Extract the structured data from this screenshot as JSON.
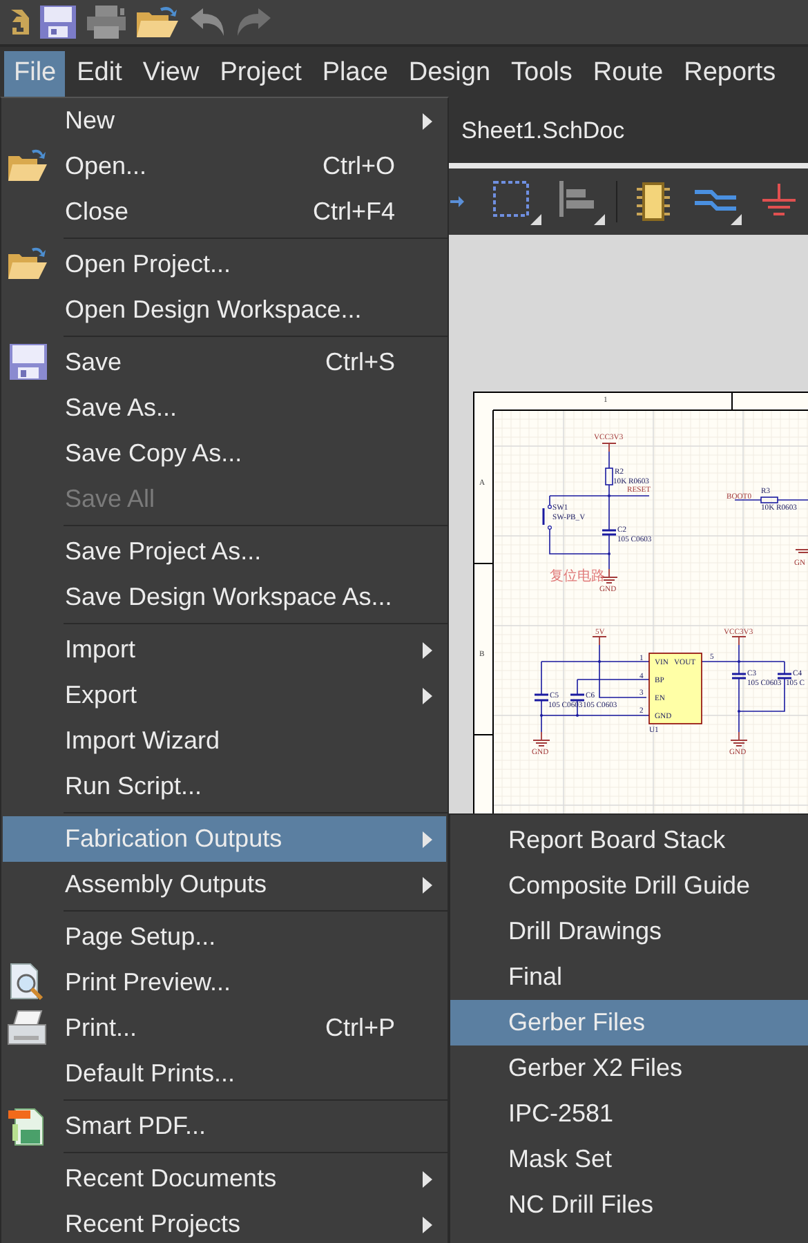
{
  "menu_bar": [
    {
      "label": "File",
      "selected": true
    },
    {
      "label": "Edit",
      "selected": false
    },
    {
      "label": "View",
      "selected": false
    },
    {
      "label": "Project",
      "selected": false
    },
    {
      "label": "Place",
      "selected": false
    },
    {
      "label": "Design",
      "selected": false
    },
    {
      "label": "Tools",
      "selected": false
    },
    {
      "label": "Route",
      "selected": false
    },
    {
      "label": "Reports",
      "selected": false
    }
  ],
  "document_tab": {
    "label": "Sheet1.SchDoc"
  },
  "schematic": {
    "labels": [
      "1",
      "A",
      "B",
      "VCC3V3",
      "R2",
      "10K R0603",
      "RESET",
      "SW1",
      "SW-PB_V",
      "C2",
      "105 C0603",
      "复位电路",
      "GND",
      "BOOT0",
      "R3",
      "10K R0603",
      "GN",
      "5V",
      "VCC3V3",
      "VIN",
      "VOUT",
      "BP",
      "EN",
      "GND",
      "1",
      "4",
      "3",
      "2",
      "5",
      "U1",
      "C5",
      "105 C0603",
      "C6",
      "105 C0603",
      "GND",
      "C3",
      "105 C0603",
      "C4",
      "105 C",
      "GND"
    ]
  },
  "file_menu": {
    "groups": [
      [
        {
          "label": "New",
          "submenu": true,
          "disabled": false,
          "selected": false
        },
        {
          "label": "Open...",
          "shortcut": "Ctrl+O",
          "submenu": false,
          "disabled": false,
          "selected": false
        },
        {
          "label": "Close",
          "shortcut": "Ctrl+F4",
          "submenu": false,
          "disabled": false,
          "selected": false
        }
      ],
      [
        {
          "label": "Open Project...",
          "submenu": false,
          "disabled": false,
          "selected": false
        },
        {
          "label": "Open Design Workspace...",
          "submenu": false,
          "disabled": false,
          "selected": false
        }
      ],
      [
        {
          "label": "Save",
          "shortcut": "Ctrl+S",
          "submenu": false,
          "disabled": false,
          "selected": false
        },
        {
          "label": "Save As...",
          "submenu": false,
          "disabled": false,
          "selected": false
        },
        {
          "label": "Save Copy As...",
          "submenu": false,
          "disabled": false,
          "selected": false
        },
        {
          "label": "Save All",
          "submenu": false,
          "disabled": true,
          "selected": false
        }
      ],
      [
        {
          "label": "Save Project As...",
          "submenu": false,
          "disabled": false,
          "selected": false
        },
        {
          "label": "Save Design Workspace As...",
          "submenu": false,
          "disabled": false,
          "selected": false
        }
      ],
      [
        {
          "label": "Import",
          "submenu": true,
          "disabled": false,
          "selected": false
        },
        {
          "label": "Export",
          "submenu": true,
          "disabled": false,
          "selected": false
        },
        {
          "label": "Import Wizard",
          "submenu": false,
          "disabled": false,
          "selected": false
        },
        {
          "label": "Run Script...",
          "submenu": false,
          "disabled": false,
          "selected": false
        }
      ],
      [
        {
          "label": "Fabrication Outputs",
          "submenu": true,
          "disabled": false,
          "selected": true
        },
        {
          "label": "Assembly Outputs",
          "submenu": true,
          "disabled": false,
          "selected": false
        }
      ],
      [
        {
          "label": "Page Setup...",
          "submenu": false,
          "disabled": false,
          "selected": false
        },
        {
          "label": "Print Preview...",
          "submenu": false,
          "disabled": false,
          "selected": false
        },
        {
          "label": "Print...",
          "shortcut": "Ctrl+P",
          "submenu": false,
          "disabled": false,
          "selected": false
        },
        {
          "label": "Default Prints...",
          "submenu": false,
          "disabled": false,
          "selected": false
        }
      ],
      [
        {
          "label": "Smart PDF...",
          "submenu": false,
          "disabled": false,
          "selected": false
        }
      ],
      [
        {
          "label": "Recent Documents",
          "submenu": true,
          "disabled": false,
          "selected": false
        },
        {
          "label": "Recent Projects",
          "submenu": true,
          "disabled": false,
          "selected": false
        }
      ]
    ]
  },
  "fabrication_submenu": {
    "items": [
      {
        "label": "Report Board Stack",
        "selected": false
      },
      {
        "label": "Composite Drill Guide",
        "selected": false
      },
      {
        "label": "Drill Drawings",
        "selected": false
      },
      {
        "label": "Final",
        "selected": false
      },
      {
        "label": "Gerber Files",
        "selected": true
      },
      {
        "label": "Gerber X2 Files",
        "selected": false
      },
      {
        "label": "IPC-2581",
        "selected": false
      },
      {
        "label": "Mask Set",
        "selected": false
      },
      {
        "label": "NC Drill Files",
        "selected": false
      }
    ]
  }
}
